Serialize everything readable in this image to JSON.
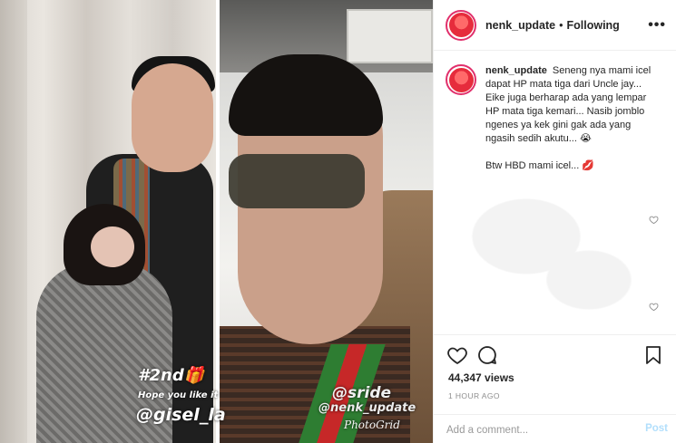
{
  "media": {
    "left_panel": {
      "sticker_main": "#2nd🎁",
      "sticker_sub": "Hope you like it",
      "sticker_handle": "@gisel_la"
    },
    "right_panel": {
      "sticker_handle": "@sride",
      "watermark_handle": "@nenk_update",
      "app_watermark": "PhotoGrid"
    }
  },
  "header": {
    "username": "nenk_update",
    "separator": "•",
    "follow_status": "Following",
    "more_icon": "more-options-icon",
    "avatar_text": "Nenk Update"
  },
  "caption": {
    "username": "nenk_update",
    "text": "Seneng nya mami icel dapat HP mata tiga dari Uncle jay... Eike juga berharap ada yang lempar HP mata tiga kemari... Nasib jomblo ngenes ya kek gini gak ada yang ngasih sedih akutu... 😭",
    "text_2": "Btw HBD mami icel... 💋"
  },
  "actions": {
    "like_icon": "heart-icon",
    "comment_icon": "comment-icon",
    "save_icon": "bookmark-icon",
    "views": "44,347 views",
    "time": "1 HOUR AGO"
  },
  "comment_box": {
    "placeholder": "Add a comment...",
    "post_label": "Post"
  },
  "colors": {
    "accent_ring": "#e1306c",
    "post_disabled": "#b2dffc",
    "muted": "#8e8e8e"
  }
}
